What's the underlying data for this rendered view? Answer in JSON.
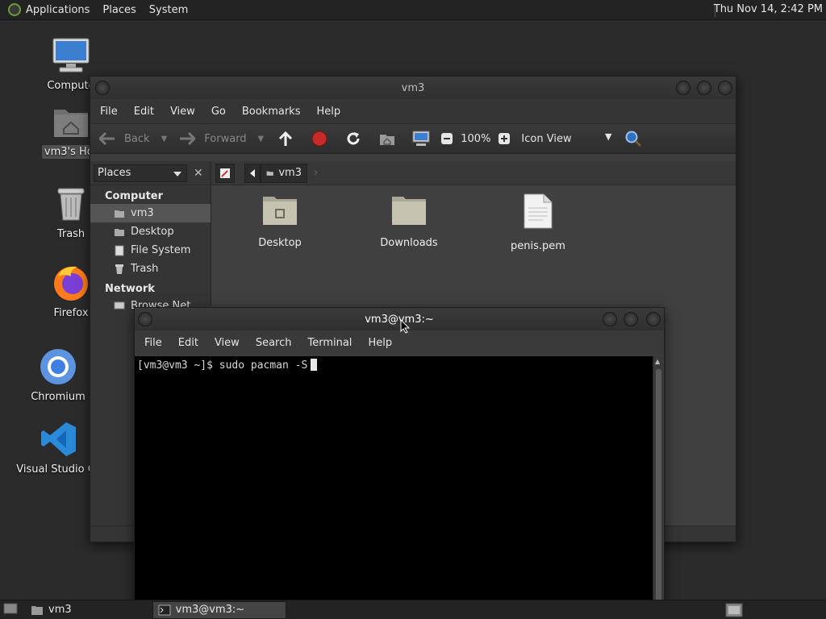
{
  "top_panel": {
    "menus": [
      "Applications",
      "Places",
      "System"
    ],
    "clock": "Thu Nov 14,  2:42 PM"
  },
  "desktop_icons": [
    {
      "label": "Compute",
      "icon": "computer-icon"
    },
    {
      "label": "vm3's Hor",
      "icon": "home-folder-icon"
    },
    {
      "label": "Trash",
      "icon": "trash-icon"
    },
    {
      "label": "Firefox",
      "icon": "firefox-icon"
    },
    {
      "label": "Chromium",
      "icon": "chromium-icon"
    },
    {
      "label": "Visual Studio Co",
      "icon": "vscode-icon"
    }
  ],
  "file_manager": {
    "title": "vm3",
    "menus": [
      "File",
      "Edit",
      "View",
      "Go",
      "Bookmarks",
      "Help"
    ],
    "toolbar": {
      "back": "Back",
      "forward": "Forward",
      "zoom": "100%",
      "view_mode": "Icon View"
    },
    "sidebar": {
      "selector": "Places",
      "sections": [
        {
          "title": "Computer",
          "items": [
            "vm3",
            "Desktop",
            "File System",
            "Trash"
          ]
        },
        {
          "title": "Network",
          "items": [
            "Browse Net"
          ]
        }
      ],
      "selected": "vm3"
    },
    "path": {
      "current": "vm3"
    },
    "files": [
      {
        "name": "Desktop",
        "icon": "desktop-folder-icon"
      },
      {
        "name": "Downloads",
        "icon": "folder-icon"
      },
      {
        "name": "penis.pem",
        "icon": "text-file-icon"
      }
    ]
  },
  "terminal": {
    "title": "vm3@vm3:~",
    "menus": [
      "File",
      "Edit",
      "View",
      "Search",
      "Terminal",
      "Help"
    ],
    "prompt": "[vm3@vm3 ~]$ sudo pacman -S"
  },
  "bottom_panel": {
    "tasks": [
      {
        "label": "vm3",
        "icon": "folder-icon"
      },
      {
        "label": "vm3@vm3:~",
        "icon": "terminal-icon"
      }
    ]
  }
}
